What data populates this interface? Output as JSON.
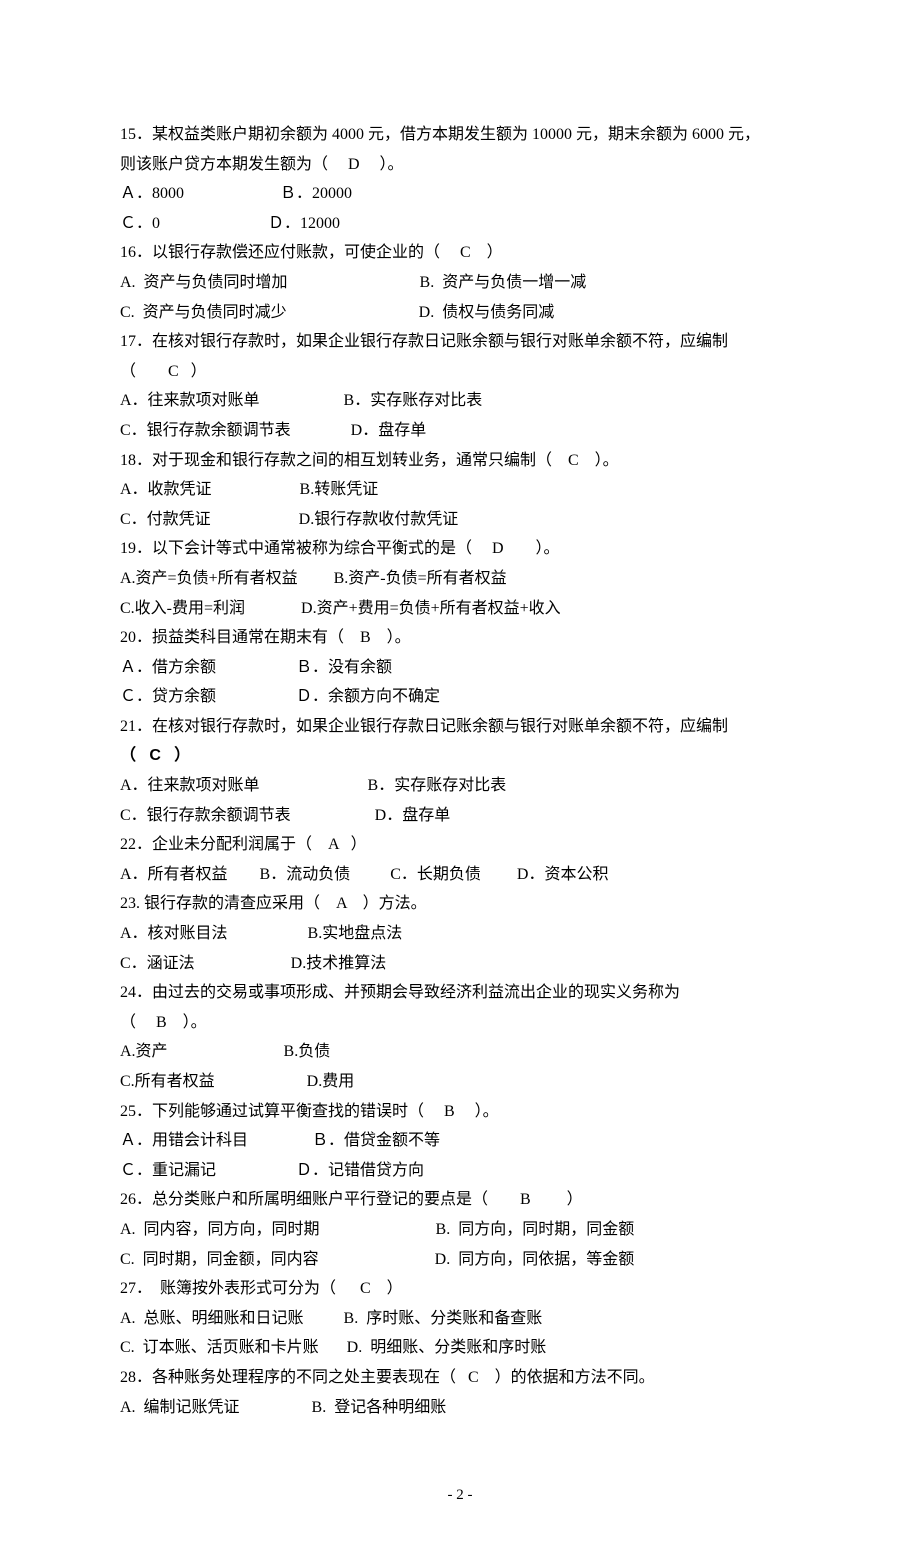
{
  "questions": [
    {
      "num": "15",
      "stem": [
        "15．某权益类账户期初余额为 4000 元，借方本期发生额为 10000 元，期末余额为 6000 元，",
        "则该账户贷方本期发生额为（     D     ）。"
      ],
      "opts": [
        "Ａ．8000                        Ｂ．20000",
        "Ｃ．0                           Ｄ．12000"
      ]
    },
    {
      "num": "16",
      "stem": [
        "16．以银行存款偿还应付账款，可使企业的（     C    ）"
      ],
      "opts": [
        "A.  资产与负债同时增加                                 B.  资产与负债一增一减",
        "C.  资产与负债同时减少                                 D.  债权与债务同减"
      ]
    },
    {
      "num": "17",
      "stem": [
        "17．在核对银行存款时，如果企业银行存款日记账余额与银行对账单余额不符，应编制",
        "（        C   ）"
      ],
      "opts": [
        "A．往来款项对账单                     B．实存账存对比表",
        "C．银行存款余额调节表               D．盘存单"
      ]
    },
    {
      "num": "18",
      "stem": [
        "18．对于现金和银行存款之间的相互划转业务，通常只编制（    C    ）。"
      ],
      "opts": [
        "A．收款凭证                      B.转账凭证",
        "C．付款凭证                      D.银行存款收付款凭证"
      ]
    },
    {
      "num": "19",
      "stem": [
        "19．以下会计等式中通常被称为综合平衡式的是（     D        ）。"
      ],
      "opts": [
        "A.资产=负债+所有者权益         B.资产-负债=所有者权益",
        "C.收入-费用=利润              D.资产+费用=负债+所有者权益+收入"
      ]
    },
    {
      "num": "20",
      "stem": [
        "20．损益类科目通常在期末有（    B    ）。"
      ],
      "opts": [
        "Ａ．借方余额                    Ｂ．没有余额",
        "Ｃ．贷方余额                    Ｄ．余额方向不确定"
      ]
    },
    {
      "num": "21",
      "stem_parts": [
        {
          "text": "21．在核对银行存款时，如果企业银行存款日记账余额与银行对账单余额不符，应编制",
          "bold": false
        },
        {
          "text": "（   C   ）",
          "bold": true
        }
      ],
      "opts": [
        "A．往来款项对账单                           B．实存账存对比表",
        "C．银行存款余额调节表                     D．盘存单"
      ]
    },
    {
      "num": "22",
      "stem": [
        "22．企业未分配利润属于（    A   ）"
      ],
      "opts": [
        "A．所有者权益        B．流动负债          C．长期负债         D．资本公积"
      ]
    },
    {
      "num": "23",
      "stem": [
        "23. 银行存款的清查应采用（    A    ）方法。"
      ],
      "opts": [
        "A．核对账目法                    B.实地盘点法",
        "C．涵证法                        D.技术推算法"
      ]
    },
    {
      "num": "24",
      "stem": [
        "24．由过去的交易或事项形成、并预期会导致经济利益流出企业的现实义务称为",
        "（     B    ）。"
      ],
      "opts": [
        "A.资产                             B.负债",
        "C.所有者权益                       D.费用"
      ]
    },
    {
      "num": "25",
      "stem": [
        "25．下列能够通过试算平衡查找的错误时（     B     ）。"
      ],
      "opts": [
        "Ａ．用错会计科目                Ｂ．借贷金额不等",
        "Ｃ．重记漏记                    Ｄ．记错借贷方向"
      ]
    },
    {
      "num": "26",
      "stem": [
        "26．总分类账户和所属明细账户平行登记的要点是（        B         ）"
      ],
      "opts": [
        "A.  同内容，同方向，同时期                             B.  同方向，同时期，同金额",
        "C.  同时期，同金额，同内容                             D.  同方向，同依据，等金额"
      ]
    },
    {
      "num": "27",
      "stem": [
        "27．  账簿按外表形式可分为（      C    ）"
      ],
      "opts": [
        "A.  总账、明细账和日记账          B.  序时账、分类账和备查账",
        "C.  订本账、活页账和卡片账       D.  明细账、分类账和序时账"
      ]
    },
    {
      "num": "28",
      "stem": [
        "28．各种账务处理程序的不同之处主要表现在（   C    ）的依据和方法不同。"
      ],
      "opts": [
        "A.  编制记账凭证                  B.  登记各种明细账"
      ]
    }
  ],
  "pageNumber": "- 2 -"
}
